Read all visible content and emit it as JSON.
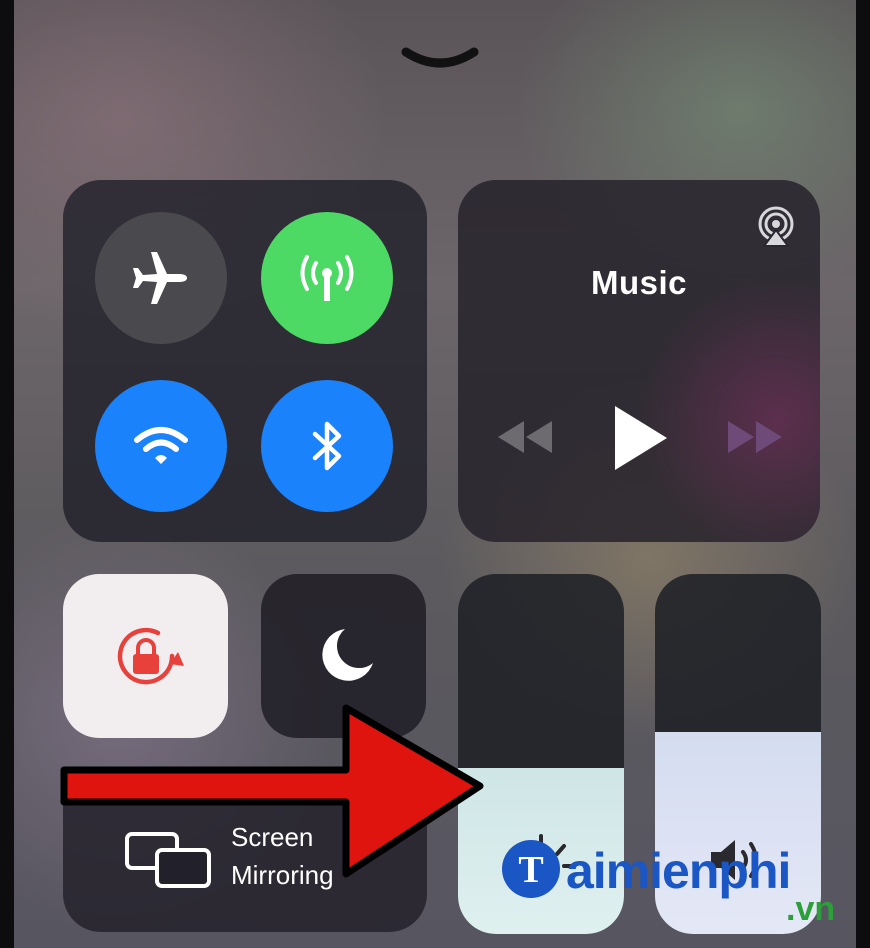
{
  "control_center": {
    "collapse_icon": "chevron-down-icon",
    "connectivity": {
      "airplane": {
        "icon": "airplane-icon",
        "state": "off",
        "color": "#4a4a4e"
      },
      "cellular": {
        "icon": "cellular-antenna-icon",
        "state": "on",
        "color": "#4cd964"
      },
      "wifi": {
        "icon": "wifi-icon",
        "state": "on",
        "color": "#1a82fb"
      },
      "bluetooth": {
        "icon": "bluetooth-icon",
        "state": "on",
        "color": "#1a82fb"
      }
    },
    "music": {
      "title": "Music",
      "airplay_icon": "airplay-icon",
      "controls": [
        "rewind-icon",
        "play-icon",
        "fast-forward-icon"
      ]
    },
    "orientation_lock": {
      "icon": "rotation-lock-icon",
      "state": "on",
      "color": "#e8413c"
    },
    "do_not_disturb": {
      "icon": "moon-icon",
      "state": "off"
    },
    "screen_mirroring": {
      "label_line1": "Screen",
      "label_line2": "Mirroring",
      "icon": "screen-mirroring-icon"
    },
    "brightness": {
      "icon": "sun-icon",
      "level_percent": 46
    },
    "volume": {
      "icon": "speaker-icon",
      "level_percent": 56
    }
  },
  "annotation": {
    "arrow_color": "#e0140f",
    "icon": "red-arrow"
  },
  "watermark": {
    "brand": "aimienphi",
    "domain": ".vn",
    "logo_letter": "T"
  }
}
